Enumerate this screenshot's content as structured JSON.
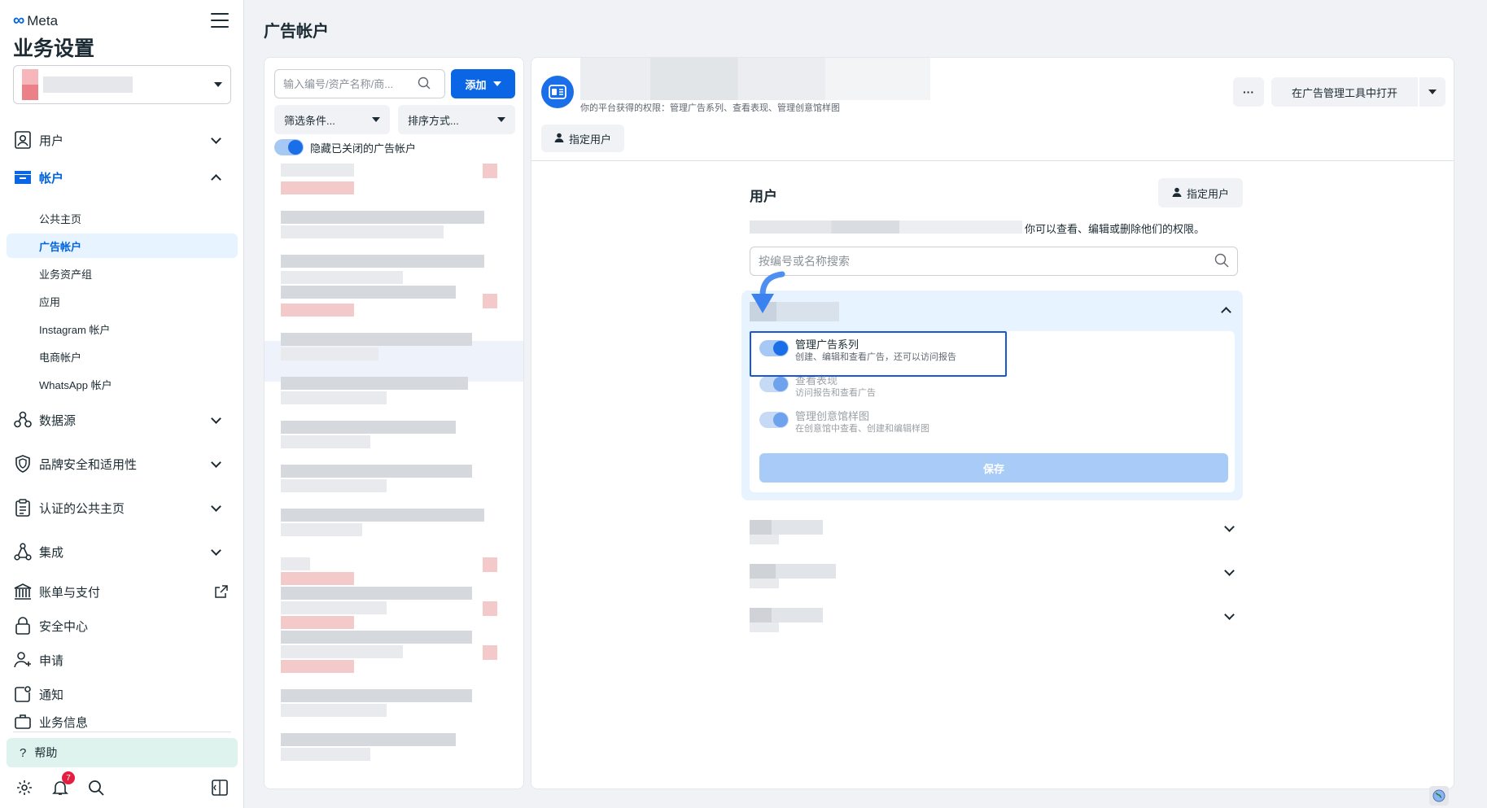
{
  "sidebar": {
    "brand": "Meta",
    "title": "业务设置",
    "nav": {
      "users": "用户",
      "accounts": "帐户",
      "data_sources": "数据源",
      "brand_safety": "品牌安全和适用性",
      "verified_pages": "认证的公共主页",
      "integrations": "集成",
      "billing": "账单与支付",
      "security": "安全中心",
      "requests": "申请",
      "notifications": "通知",
      "business_info": "业务信息"
    },
    "sub": {
      "pages": "公共主页",
      "ad_accounts": "广告帐户",
      "asset_groups": "业务资产组",
      "apps": "应用",
      "instagram": "Instagram 帐户",
      "commerce": "电商帐户",
      "whatsapp": "WhatsApp 帐户"
    },
    "help": "帮助",
    "notification_count": "7"
  },
  "page_title": "广告帐户",
  "list_panel": {
    "search_placeholder": "输入编号/资产名称/商...",
    "add_label": "添加",
    "filter_label": "筛选条件...",
    "sort_label": "排序方式...",
    "hide_closed_label": "隐藏已关闭的广告帐户"
  },
  "detail": {
    "permission_note": "你的平台获得的权限：管理广告系列、查看表现、管理创意馆样图",
    "more_label": "···",
    "open_in_ads_manager": "在广告管理工具中打开",
    "assign_user_label": "指定用户",
    "users": {
      "title": "用户",
      "assign_label": "指定用户",
      "desc": "你可以查看、编辑或删除他们的权限。",
      "search_placeholder": "按编号或名称搜索",
      "permissions": [
        {
          "label": "管理广告系列",
          "sub": "创建、编辑和查看广告，还可以访问报告"
        },
        {
          "label": "查看表现",
          "sub": "访问报告和查看广告"
        },
        {
          "label": "管理创意馆样图",
          "sub": "在创意馆中查看、创建和编辑样图"
        }
      ],
      "save_label": "保存"
    }
  },
  "colors": {
    "accent": "#0a66e4",
    "active_bg": "#e7f3ff",
    "help_bg": "#dff3ee"
  }
}
